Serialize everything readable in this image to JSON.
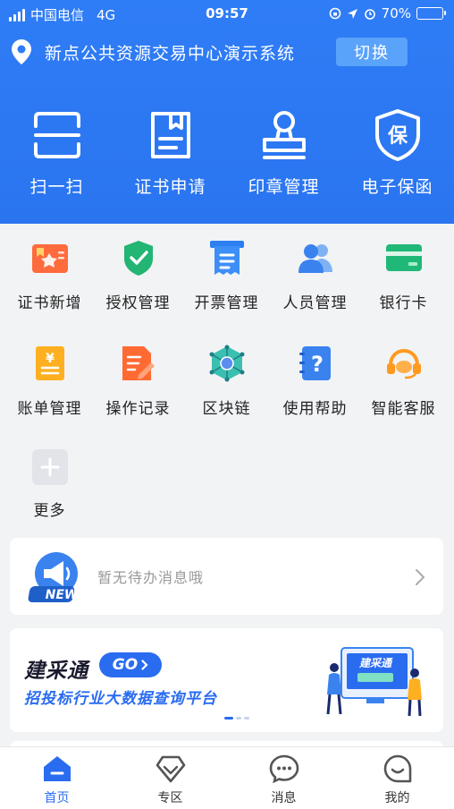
{
  "status_bar": {
    "carrier": "中国电信",
    "network": "4G",
    "time": "09:57",
    "battery": "70%",
    "battery_level": 0.7
  },
  "header": {
    "title": "新点公共资源交易中心演示系统",
    "switch_label": "切换"
  },
  "quick_actions": [
    {
      "label": "扫一扫",
      "icon": "scan-icon"
    },
    {
      "label": "证书申请",
      "icon": "certificate-apply-icon"
    },
    {
      "label": "印章管理",
      "icon": "seal-icon"
    },
    {
      "label": "电子保函",
      "icon": "guarantee-icon"
    }
  ],
  "services": [
    {
      "label": "证书新增",
      "icon": "certificate-add-icon"
    },
    {
      "label": "授权管理",
      "icon": "shield-check-icon"
    },
    {
      "label": "开票管理",
      "icon": "invoice-icon"
    },
    {
      "label": "人员管理",
      "icon": "people-icon"
    },
    {
      "label": "银行卡",
      "icon": "bank-card-icon"
    },
    {
      "label": "账单管理",
      "icon": "bill-icon"
    },
    {
      "label": "操作记录",
      "icon": "operation-log-icon"
    },
    {
      "label": "区块链",
      "icon": "blockchain-icon"
    },
    {
      "label": "使用帮助",
      "icon": "help-icon"
    },
    {
      "label": "智能客服",
      "icon": "headset-icon"
    },
    {
      "label": "更多",
      "icon": "plus-icon"
    }
  ],
  "notice": {
    "text": "暂无待办消息哦",
    "badge": "NEW"
  },
  "banner": {
    "brand": "建采通",
    "go": "GO",
    "subtitle": "招投标行业大数据查询平台",
    "screen_text": "建采通"
  },
  "tabs": [
    {
      "label": "首页",
      "icon": "home-icon",
      "active": true
    },
    {
      "label": "专区",
      "icon": "diamond-icon",
      "active": false
    },
    {
      "label": "消息",
      "icon": "message-icon",
      "active": false
    },
    {
      "label": "我的",
      "icon": "profile-icon",
      "active": false
    }
  ],
  "colors": {
    "primary": "#2a74f0",
    "active_tab": "#2a6cf0",
    "background": "#f2f3f5"
  }
}
